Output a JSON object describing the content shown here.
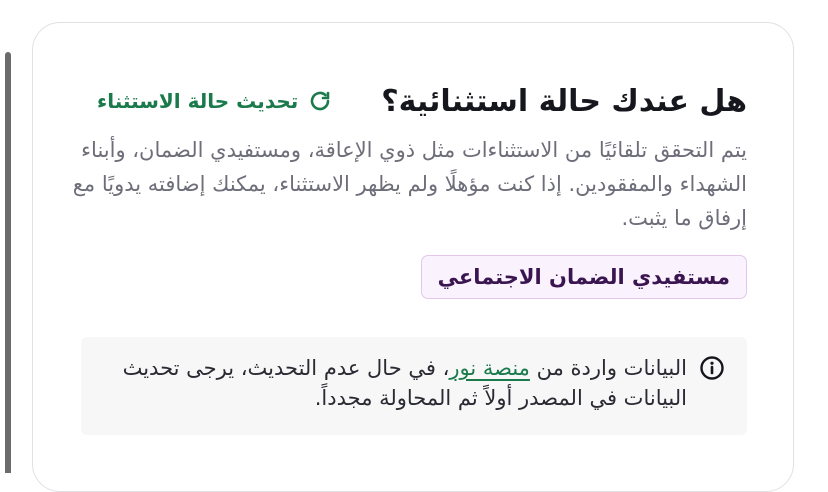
{
  "section": {
    "title": "هل عندك حالة استثنائية؟",
    "refresh_label": "تحديث حالة الاستثناء",
    "refresh_icon": "refresh-icon",
    "description": "يتم التحقق تلقائيًا من الاستثناءات مثل ذوي الإعاقة، ومستفيدي الضمان، وأبناء الشهداء والمفقودين. إذا كنت مؤهلًا ولم يظهر الاستثناء، يمكنك إضافته يدويًا مع إرفاق ما يثبت.",
    "badge_label": "مستفيدي الضمان الاجتماعي"
  },
  "info": {
    "icon": "info-icon",
    "text_before": "البيانات واردة من ",
    "link_label": "منصة نور",
    "text_after": "، في حال عدم التحديث، يرجى تحديث البيانات في المصدر أولاً ثم المحاولة مجدداً."
  },
  "colors": {
    "accent_green": "#1b7a4b",
    "badge_border": "#e2c6ee",
    "badge_bg": "#faf2fd",
    "badge_text": "#3a1550"
  }
}
